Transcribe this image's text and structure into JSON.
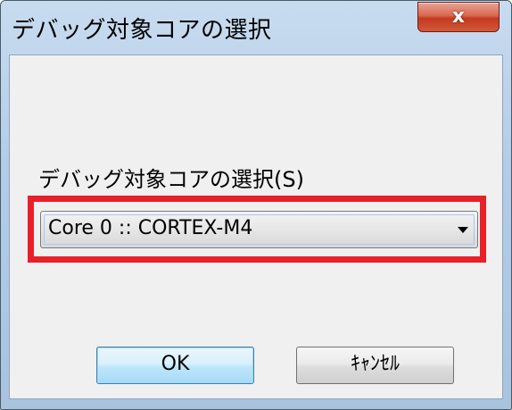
{
  "window": {
    "title": "デバッグ対象コアの選択",
    "close_label": "x"
  },
  "form": {
    "label": "デバッグ対象コアの選択(S)",
    "core_select": {
      "value": "Core 0 :: CORTEX-M4"
    }
  },
  "buttons": {
    "ok_label": "OK",
    "cancel_label": "ｷｬﾝｾﾙ"
  },
  "colors": {
    "highlight": "#e8202a",
    "titlebar": "#b4cce6",
    "close_button": "#c43a1e"
  }
}
